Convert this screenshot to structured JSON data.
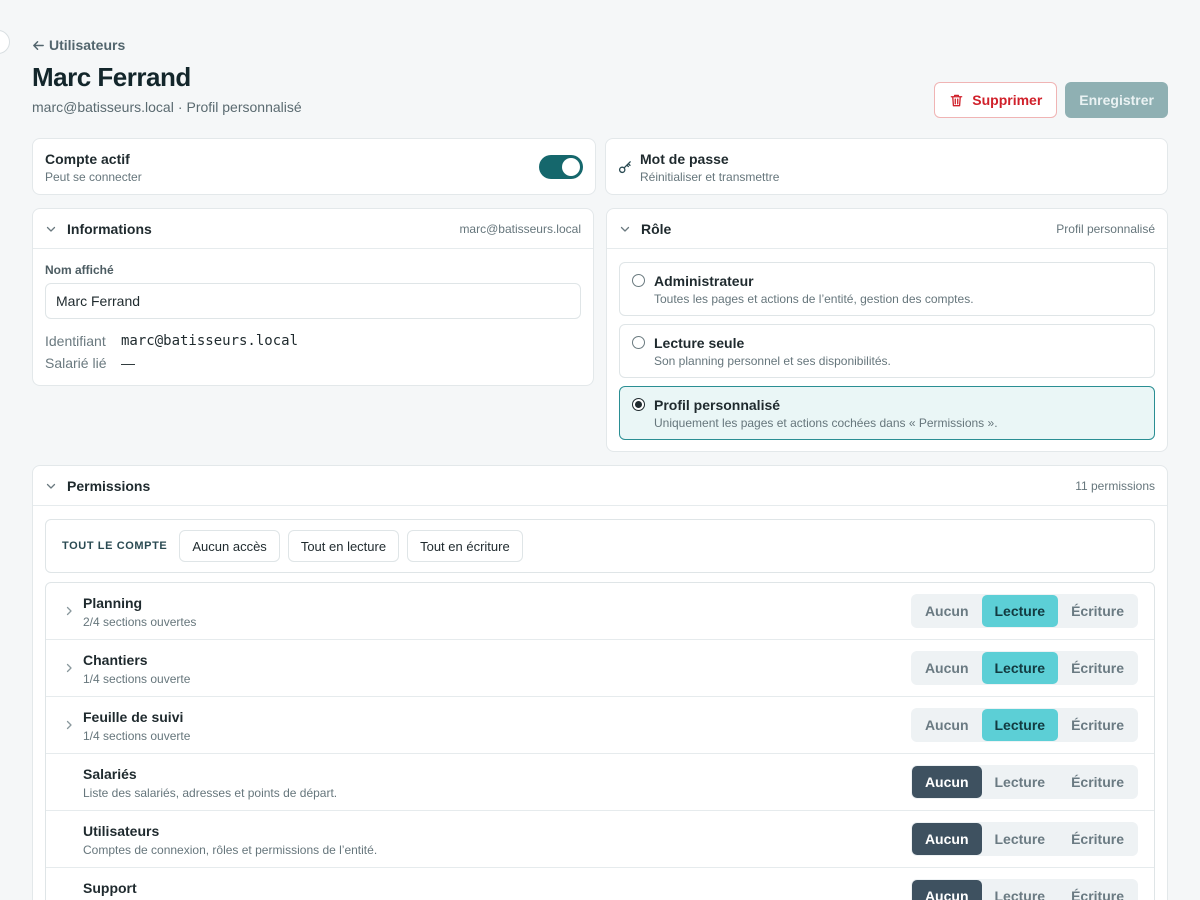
{
  "nav": {
    "back_label": "Utilisateurs"
  },
  "header": {
    "title": "Marc Ferrand",
    "email": "marc@batisseurs.local",
    "separator": "·",
    "profile": "Profil personnalisé",
    "delete_label": "Supprimer",
    "save_label": "Enregistrer"
  },
  "account": {
    "title": "Compte actif",
    "desc": "Peut se connecter",
    "active": true
  },
  "password": {
    "title": "Mot de passe",
    "desc": "Réinitialiser et transmettre"
  },
  "info": {
    "title": "Informations",
    "meta": "marc@batisseurs.local",
    "display_name_label": "Nom affiché",
    "display_name_value": "Marc Ferrand",
    "identifier_label": "Identifiant",
    "identifier_value": "marc@batisseurs.local",
    "employee_label": "Salarié lié",
    "employee_value": "—"
  },
  "role": {
    "title": "Rôle",
    "meta": "Profil personnalisé",
    "options": [
      {
        "title": "Administrateur",
        "desc": "Toutes les pages et actions de l’entité, gestion des comptes.",
        "selected": false
      },
      {
        "title": "Lecture seule",
        "desc": "Son planning personnel et ses disponibilités.",
        "selected": false
      },
      {
        "title": "Profil personnalisé",
        "desc": "Uniquement les pages et actions cochées dans « Permissions ».",
        "selected": true
      }
    ]
  },
  "permissions": {
    "title": "Permissions",
    "count": "11 permissions",
    "bulk_label": "TOUT LE COMPTE",
    "bulk_none": "Aucun accès",
    "bulk_read": "Tout en lecture",
    "bulk_write": "Tout en écriture",
    "levels": [
      "Aucun",
      "Lecture",
      "Écriture"
    ],
    "rows": [
      {
        "name": "Planning",
        "desc": "2/4 sections ouvertes",
        "level": "Lecture",
        "expandable": true
      },
      {
        "name": "Chantiers",
        "desc": "1/4 sections ouverte",
        "level": "Lecture",
        "expandable": true
      },
      {
        "name": "Feuille de suivi",
        "desc": "1/4 sections ouverte",
        "level": "Lecture",
        "expandable": true
      },
      {
        "name": "Salariés",
        "desc": "Liste des salariés, adresses et points de départ.",
        "level": "Aucun",
        "expandable": false
      },
      {
        "name": "Utilisateurs",
        "desc": "Comptes de connexion, rôles et permissions de l’entité.",
        "level": "Aucun",
        "expandable": false
      },
      {
        "name": "Support",
        "desc": "",
        "level": "Aucun",
        "expandable": false
      }
    ]
  },
  "colors": {
    "accent": "#15676c",
    "read_active": "#5ccfd6",
    "none_active": "#3e5160",
    "danger": "#d0202a"
  }
}
